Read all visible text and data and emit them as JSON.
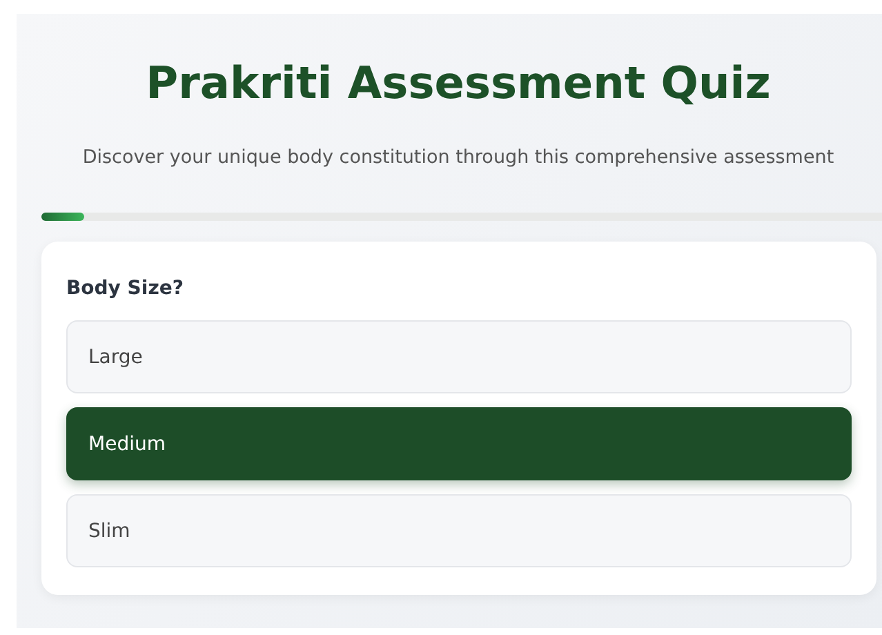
{
  "title": "Prakriti Assessment Quiz",
  "subtitle": "Discover your unique body constitution through this comprehensive assessment",
  "progress": {
    "level": 0.05
  },
  "question": {
    "text": "Body Size?",
    "options": [
      {
        "label": "Large",
        "selected": false
      },
      {
        "label": "Medium",
        "selected": true
      },
      {
        "label": "Slim",
        "selected": false
      }
    ]
  }
}
